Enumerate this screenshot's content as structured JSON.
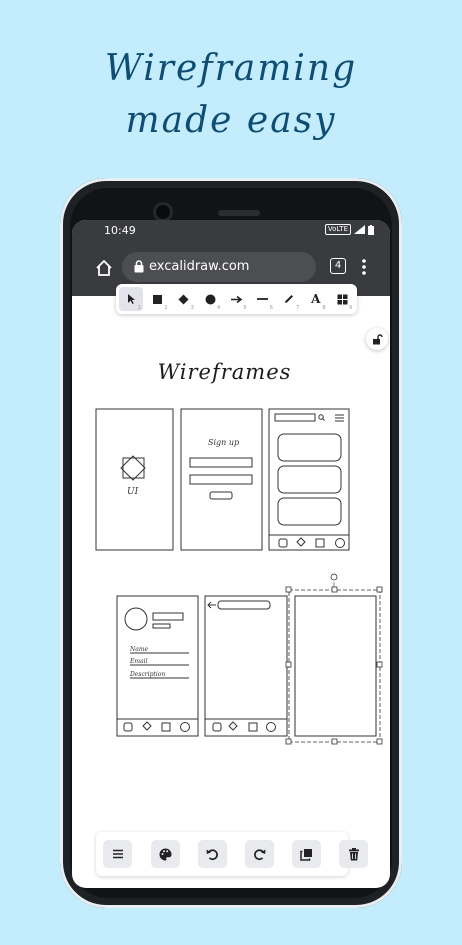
{
  "headline": {
    "line1": "Wireframing",
    "line2": "made easy"
  },
  "status": {
    "time": "10:49",
    "network": "VoLTE"
  },
  "browser": {
    "url": "excalidraw.com",
    "tab_count": "4"
  },
  "toolbar": {
    "tools": [
      {
        "icon": "pointer-icon",
        "key": "1"
      },
      {
        "icon": "square-icon",
        "key": "2"
      },
      {
        "icon": "diamond-icon",
        "key": "3"
      },
      {
        "icon": "circle-icon",
        "key": "4"
      },
      {
        "icon": "arrow-icon",
        "key": "5"
      },
      {
        "icon": "line-icon",
        "key": "6"
      },
      {
        "icon": "pencil-icon",
        "key": "7"
      },
      {
        "icon": "text-icon",
        "label": "A",
        "key": "8"
      },
      {
        "icon": "library-icon",
        "key": "9"
      }
    ]
  },
  "canvas": {
    "title": "Wireframes",
    "frame1_label": "UI",
    "frame2_label": "Sign up",
    "form_fields": [
      "Name",
      "Email",
      "Description"
    ]
  },
  "bottom_actions": [
    "menu-icon",
    "palette-icon",
    "undo-icon",
    "redo-icon",
    "duplicate-icon",
    "trash-icon"
  ],
  "colors": {
    "background": "#c3ecfc",
    "headline": "#0f4d73",
    "browser_bar": "#3a3b3e"
  }
}
